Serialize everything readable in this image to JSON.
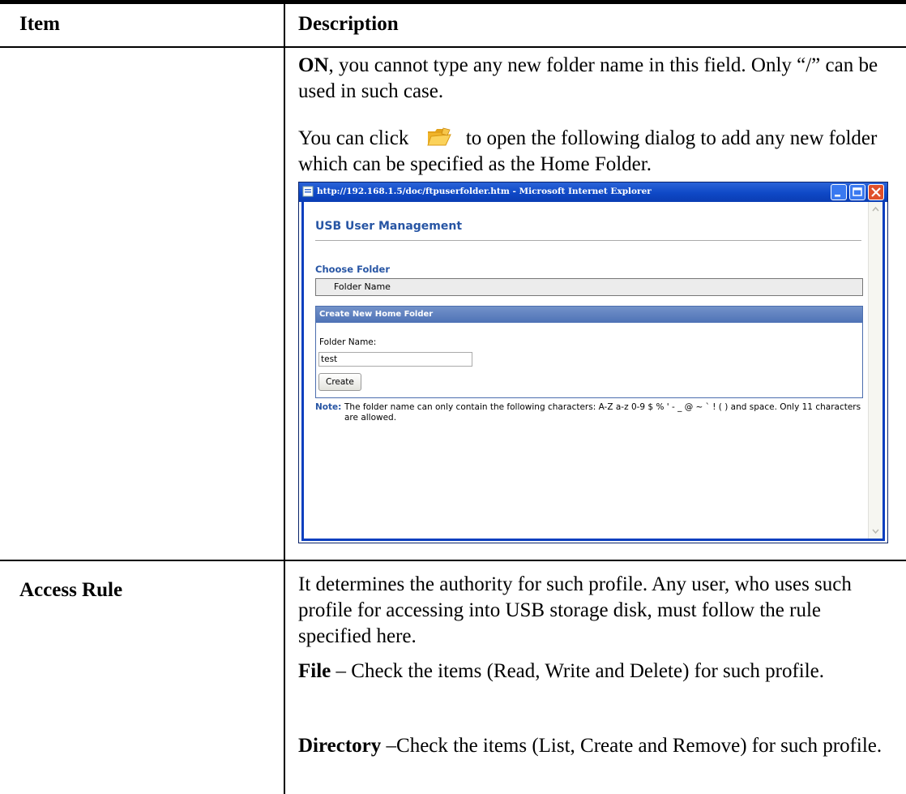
{
  "table": {
    "headers": {
      "item": "Item",
      "description": "Description"
    },
    "row1": {
      "para1_bold": "ON",
      "para1_rest": ", you cannot type any new folder name in this field. Only “/” can be used in such case.",
      "para2_before": "You can click",
      "para2_after": "to open the following dialog to add any new folder which can be specified as the Home Folder."
    },
    "row2": {
      "item": "Access Rule",
      "desc1": "It determines the authority for such profile. Any user, who uses such profile for accessing into USB storage disk, must follow the rule specified here.",
      "desc2_bold": "File",
      "desc2_rest": " – Check the items (Read, Write and Delete) for such profile.",
      "desc3_bold": "Directory",
      "desc3_rest": " –Check the items (List, Create and Remove) for such profile."
    }
  },
  "dialog": {
    "window_title": "http://192.168.1.5/doc/ftpuserfolder.htm - Microsoft Internet Explorer",
    "page_title": "USB User Management",
    "choose_folder": "Choose Folder",
    "folder_name_header": "Folder Name",
    "panel_title": "Create New Home Folder",
    "folder_name_label": "Folder Name:",
    "folder_name_value": "test",
    "create_button": "Create",
    "note_label": "Note:",
    "note_text": "The folder name can only contain the following characters: A-Z a-z 0-9 $ % ' - _ @ ~ ` ! ( ) and space. Only 11 characters are allowed."
  },
  "icons": {
    "folder_icon": "open-folder-icon",
    "colors": {
      "title_bar": "#0f48c6",
      "accent_text": "#2755a4",
      "panel_header": "#5a7cbd"
    }
  }
}
